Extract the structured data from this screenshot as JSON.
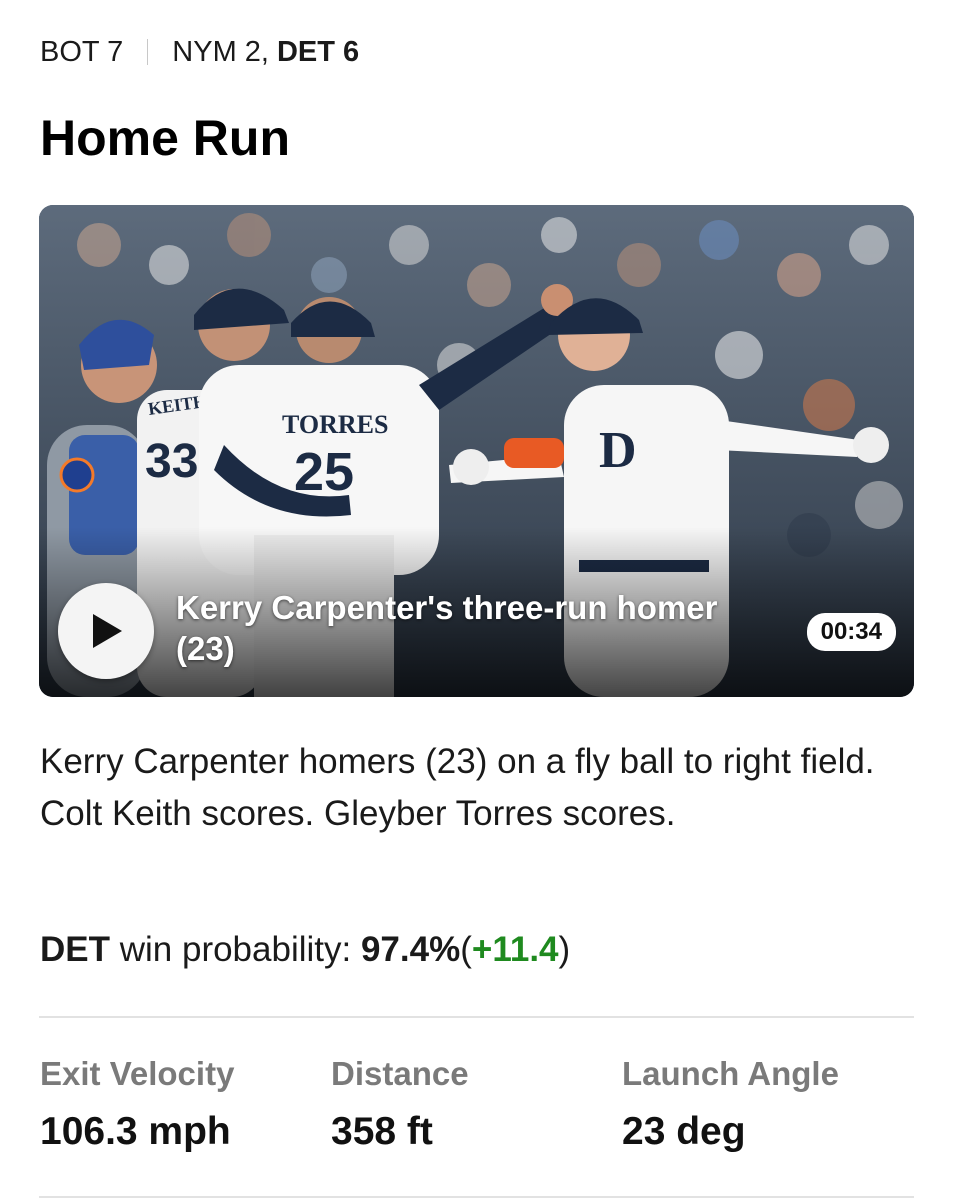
{
  "game_context": {
    "inning": "BOT 7",
    "score_away": "NYM 2,",
    "score_home": "DET 6"
  },
  "play": {
    "type": "Home Run",
    "video": {
      "title": "Kerry Carpenter's three-run homer (23)",
      "duration": "00:34",
      "jersey_names": [
        "KEITH",
        "TORRES"
      ],
      "jersey_numbers": [
        "33",
        "25"
      ]
    },
    "description": "Kerry Carpenter homers (23) on a fly ball to right field. Colt Keith scores. Gleyber Torres scores."
  },
  "win_probability": {
    "team": "DET",
    "label": "win probability:",
    "value": "97.4%",
    "open_paren": "(",
    "change": "+11.4",
    "close_paren": ")"
  },
  "statcast": [
    {
      "label": "Exit Velocity",
      "value": "106.3 mph"
    },
    {
      "label": "Distance",
      "value": "358 ft"
    },
    {
      "label": "Launch Angle",
      "value": "23 deg"
    }
  ],
  "colors": {
    "positive_change": "#1f8a1f",
    "stat_label": "#7a7a7a",
    "play_button_bg": "#f4f4f4"
  },
  "icons": {
    "play": "play-icon"
  }
}
